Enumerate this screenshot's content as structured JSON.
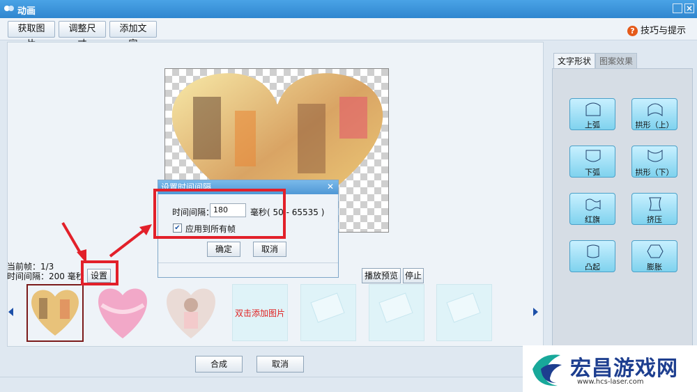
{
  "window": {
    "title": "动画"
  },
  "toolbar": {
    "get_image": "获取图片",
    "resize": "调整尺寸",
    "add_text": "添加文字",
    "help": "技巧与提示"
  },
  "frame_info": {
    "current_label": "当前帧：1/3",
    "interval_label": "时间间隔：200 毫秒",
    "settings_button": "设置"
  },
  "playback": {
    "preview_button": "播放预览",
    "stop_button": "停止"
  },
  "thumbnails": {
    "add_image_text": "双击添加图片"
  },
  "bottom": {
    "compose_button": "合成",
    "cancel_button": "取消"
  },
  "right_panel": {
    "tabs": [
      "文字形状",
      "图案效果"
    ],
    "shapes": [
      "上弧",
      "拱形（上）",
      "下弧",
      "拱形（下）",
      "红旗",
      "挤压",
      "凸起",
      "膨胀"
    ]
  },
  "dialog": {
    "title": "设置时间间隔",
    "interval_label": "时间间隔：",
    "interval_value": "180",
    "unit_label": "毫秒( 50 - 65535 )",
    "apply_all_label": "应用到所有帧",
    "ok_button": "确定",
    "cancel_button": "取消"
  },
  "watermark": {
    "brand": "宏昌游戏网",
    "url": "www.hcs-laser.com"
  },
  "colors": {
    "highlight": "#e2202a",
    "title_bar": "#3a8fd6",
    "shape_button": "#9fe0f5"
  }
}
